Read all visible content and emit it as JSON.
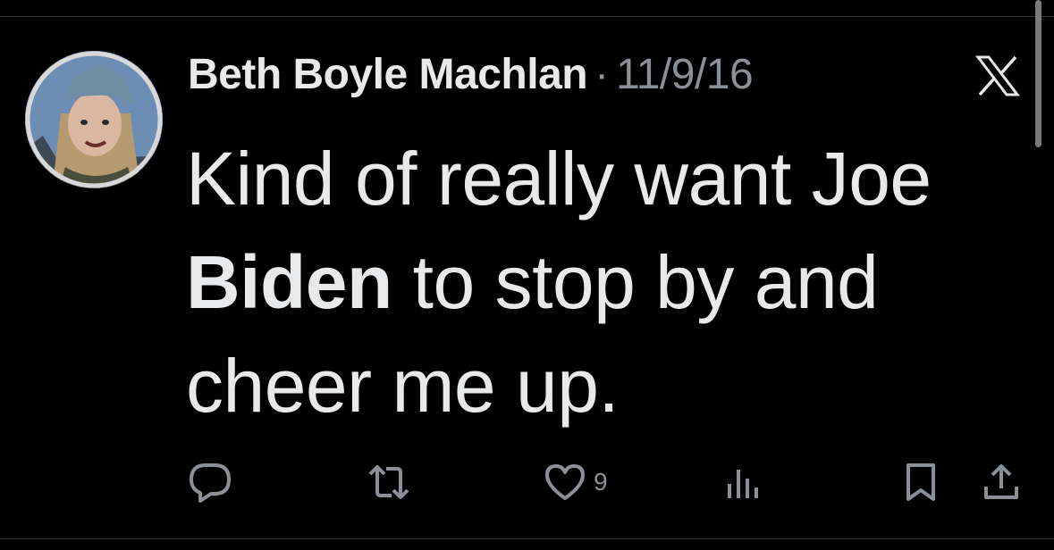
{
  "author": {
    "name": "Beth Boyle Machlan",
    "separator": "·",
    "date": "11/9/16",
    "avatar_icon": "profile-photo"
  },
  "platform_icon": "x-logo-icon",
  "tweet": {
    "text_before": "Kind of really want Joe ",
    "text_bold": "Biden",
    "text_after": " to stop by and cheer me up."
  },
  "actions": {
    "reply_icon": "reply-icon",
    "retweet_icon": "retweet-icon",
    "like_icon": "heart-icon",
    "like_count": "9",
    "views_icon": "analytics-icon",
    "bookmark_icon": "bookmark-icon",
    "share_icon": "share-icon"
  },
  "colors": {
    "background": "#000000",
    "text_primary": "#e7e9ea",
    "text_secondary": "#8b9096",
    "divider": "#2f3336"
  }
}
